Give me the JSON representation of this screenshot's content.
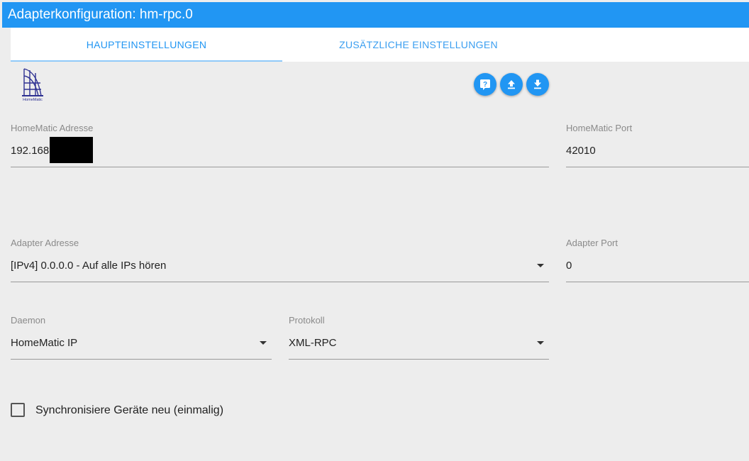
{
  "window": {
    "title": "Adapterkonfiguration: hm-rpc.0"
  },
  "tabs": [
    {
      "label": "HAUPTEINSTELLUNGEN",
      "active": true
    },
    {
      "label": "ZUSÄTZLICHE EINSTELLUNGEN",
      "active": false
    }
  ],
  "logo": {
    "caption": "HomeMatic"
  },
  "toolbar": {
    "buttons": [
      {
        "icon": "help-icon"
      },
      {
        "icon": "upload-icon"
      },
      {
        "icon": "download-icon"
      }
    ]
  },
  "fields": {
    "homematic_address": {
      "label": "HomeMatic Adresse",
      "value": "192.168"
    },
    "homematic_port": {
      "label": "HomeMatic Port",
      "value": "42010"
    },
    "adapter_address": {
      "label": "Adapter Adresse",
      "value": "[IPv4] 0.0.0.0 - Auf alle IPs hören"
    },
    "adapter_port": {
      "label": "Adapter Port",
      "value": "0"
    },
    "daemon": {
      "label": "Daemon",
      "value": "HomeMatic IP"
    },
    "protocol": {
      "label": "Protokoll",
      "value": "XML-RPC"
    }
  },
  "sync_checkbox": {
    "label": "Synchronisiere Geräte neu (einmalig)",
    "checked": false
  },
  "colors": {
    "accent": "#2196f3",
    "background": "#ededed",
    "tab_bar": "#ffffff"
  }
}
